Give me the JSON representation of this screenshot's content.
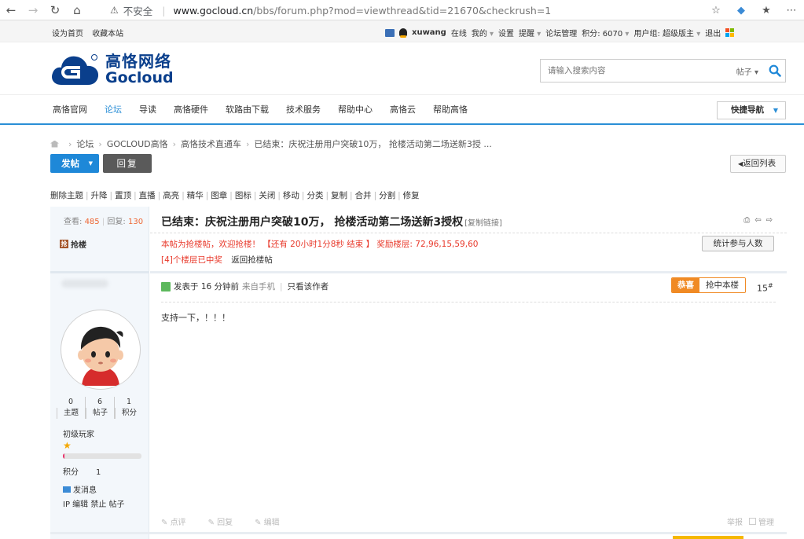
{
  "browser": {
    "insecure_label": "不安全",
    "url_host": "www.gocloud.cn",
    "url_path": "/bbs/forum.php?mod=viewthread&tid=21670&checkrush=1"
  },
  "topbar": {
    "set_home": "设为首页",
    "bookmark": "收藏本站",
    "username": "xuwang",
    "status": "在线",
    "my": "我的",
    "settings": "设置",
    "remind": "提醒",
    "forum_admin": "论坛管理",
    "points": "积分: 6070",
    "usergroup": "用户组: 超级版主",
    "logout": "退出"
  },
  "header": {
    "logo_cn": "高恪网络",
    "logo_en": "Gocloud",
    "search_placeholder": "请输入搜索内容",
    "search_type": "帖子"
  },
  "nav": {
    "items": [
      "高恪官网",
      "论坛",
      "导读",
      "高恪硬件",
      "软路由下载",
      "技术服务",
      "帮助中心",
      "高恪云",
      "帮助高恪"
    ],
    "active_index": 1,
    "quick_nav": "快捷导航"
  },
  "breadcrumb": [
    "论坛",
    "GOCLOUD高恪",
    "高恪技术直通车",
    "已结束：庆祝注册用户突破10万， 抢楼活动第二场送新3授 ..."
  ],
  "buttons": {
    "post": "发帖",
    "reply": "回复",
    "back_list": "返回列表"
  },
  "mod_actions": [
    "删除主题",
    "升降",
    "置顶",
    "直播",
    "高亮",
    "精华",
    "图章",
    "图标",
    "关闭",
    "移动",
    "分类",
    "复制",
    "合并",
    "分割",
    "修复"
  ],
  "thread": {
    "views_label": "查看:",
    "views": "485",
    "replies_label": "回复:",
    "replies": "130",
    "rush_tag": "抢楼",
    "title": "已结束：庆祝注册用户突破10万， 抢楼活动第二场送新3授权",
    "copy_link": "[复制链接]",
    "rush_info": "本帖为抢楼帖，欢迎抢楼！ 【还有 20小时1分8秒 结束 】 奖励楼层: 72,96,15,59,60",
    "won_count_prefix": "[4]",
    "won_count_suffix": "个楼层已中奖",
    "back_rush": "返回抢楼帖",
    "stat_button": "统计参与人数"
  },
  "user": {
    "topics": "0",
    "topics_label": "主题",
    "posts": "6",
    "posts_label": "帖子",
    "credits": "1",
    "credits_label": "积分",
    "rank": "初级玩家",
    "progress": 0.02,
    "score_label": "积分",
    "score": "1",
    "send_pm": "发消息",
    "ip_line": "IP 编辑 禁止 帖子"
  },
  "post": {
    "posted": "发表于 16 分钟前",
    "source": "来自手机",
    "only_author": "只看该作者",
    "congrats": "恭喜",
    "win_floor": "抢中本楼",
    "floor": "15",
    "floor_mark": "#",
    "body": "支持一下，！！！",
    "rate": "点评",
    "reply": "回复",
    "edit": "编辑",
    "report": "举报",
    "manage": "管理"
  },
  "colors": {
    "accent": "#2a8ed6",
    "rush_red": "#e8382a",
    "win_orange": "#f08a24",
    "logo_blue": "#0a3f8c"
  }
}
